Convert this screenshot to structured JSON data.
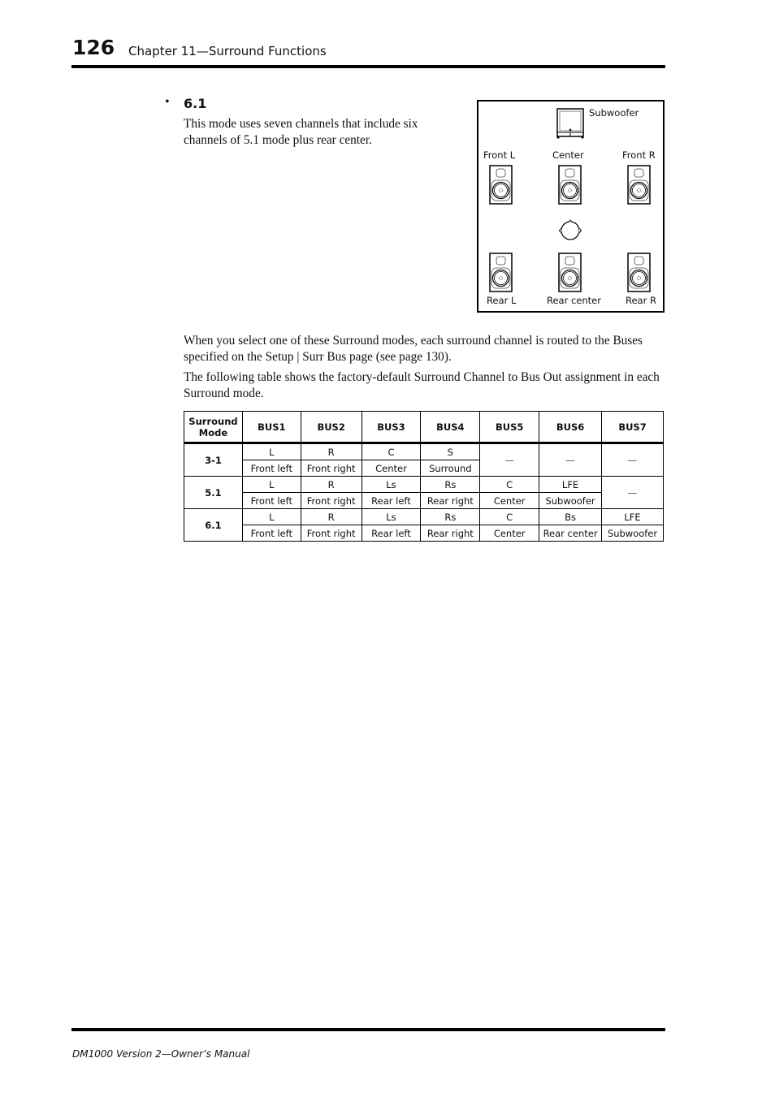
{
  "header": {
    "page_number": "126",
    "chapter_title": "Chapter 11—Surround Functions"
  },
  "section": {
    "bullet": "•",
    "title": "6.1",
    "description": "This mode uses seven channels that include six channels of 5.1 mode plus rear center."
  },
  "diagram": {
    "labels": {
      "subwoofer": "Subwoofer",
      "front_l": "Front L",
      "center": "Center",
      "front_r": "Front R",
      "rear_l": "Rear L",
      "rear_center": "Rear center",
      "rear_r": "Rear R"
    },
    "icons": [
      "subwoofer-icon",
      "speaker-icon",
      "listener-icon"
    ]
  },
  "body": {
    "paragraph1": "When you select one of these Surround modes, each surround channel is routed to the Buses specified on the Setup | Surr Bus page (see page 130).",
    "paragraph2": "The following table shows the factory-default Surround Channel to Bus Out assignment in each Surround mode."
  },
  "table": {
    "headers": [
      "Surround Mode",
      "BUS1",
      "BUS2",
      "BUS3",
      "BUS4",
      "BUS5",
      "BUS6",
      "BUS7"
    ],
    "rows": [
      {
        "mode": "3-1",
        "codes": [
          "L",
          "R",
          "C",
          "S",
          "—",
          "—",
          "—"
        ],
        "names": [
          "Front left",
          "Front right",
          "Center",
          "Surround",
          "",
          "",
          ""
        ]
      },
      {
        "mode": "5.1",
        "codes": [
          "L",
          "R",
          "Ls",
          "Rs",
          "C",
          "LFE",
          "—"
        ],
        "names": [
          "Front left",
          "Front right",
          "Rear left",
          "Rear right",
          "Center",
          "Subwoofer",
          ""
        ]
      },
      {
        "mode": "6.1",
        "codes": [
          "L",
          "R",
          "Ls",
          "Rs",
          "C",
          "Bs",
          "LFE"
        ],
        "names": [
          "Front left",
          "Front right",
          "Rear left",
          "Rear right",
          "Center",
          "Rear center",
          "Subwoofer"
        ]
      }
    ]
  },
  "footer": {
    "manual_title": "DM1000 Version 2—Owner’s Manual"
  }
}
